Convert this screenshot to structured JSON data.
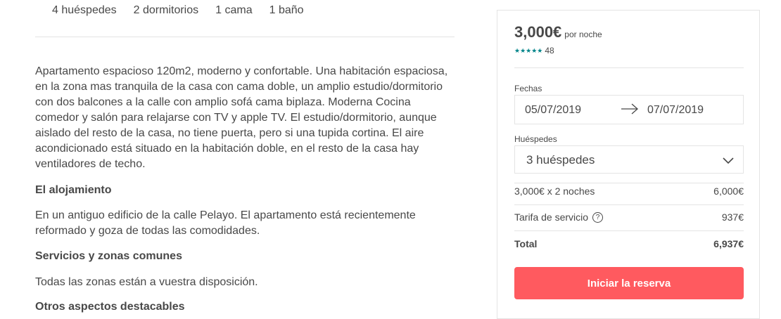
{
  "listing": {
    "stats": [
      "4 huéspedes",
      "2 dormitorios",
      "1 cama",
      "1 baño"
    ],
    "description": "Apartamento espacioso 120m2, moderno y confortable. Una habitación espaciosa, en la zona mas tranquila de la casa con cama doble, un amplio estudio/dormitorio con dos balcones a la calle con amplio sofá cama biplaza. Moderna Cocina comedor y salón para relajarse con TV y apple TV. El estudio/dormitorio, aunque aislado del resto de la casa, no tiene puerta, pero si una tupida cortina. El aire acondicionado está situado en la habitación doble, en el resto de la casa hay ventiladores de techo.",
    "sections": [
      {
        "heading": "El alojamiento",
        "text": "En un antiguo edificio de la calle Pelayo. El apartamento está recientemente reformado y goza de todas las comodidades."
      },
      {
        "heading": "Servicios y zonas comunes",
        "text": "Todas las zonas están a vuestra disposición."
      }
    ],
    "cut_heading": "Otros aspectos destacables"
  },
  "booking": {
    "price": "3,000€",
    "price_unit": "por noche",
    "stars": "★★★★★",
    "review_count": "48",
    "dates_label": "Fechas",
    "checkin": "05/07/2019",
    "checkout": "07/07/2019",
    "guests_label": "Huéspedes",
    "guests_value": "3 huéspedes",
    "nights_label": "3,000€ x 2 noches",
    "nights_amount": "6,000€",
    "fee_label": "Tarifa de servicio",
    "fee_amount": "937€",
    "total_label": "Total",
    "total_amount": "6,937€",
    "book_button": "Iniciar la reserva"
  },
  "colors": {
    "accent": "#ff5a5f",
    "stars": "#008489",
    "text": "#484848",
    "border": "#e4e4e4"
  }
}
